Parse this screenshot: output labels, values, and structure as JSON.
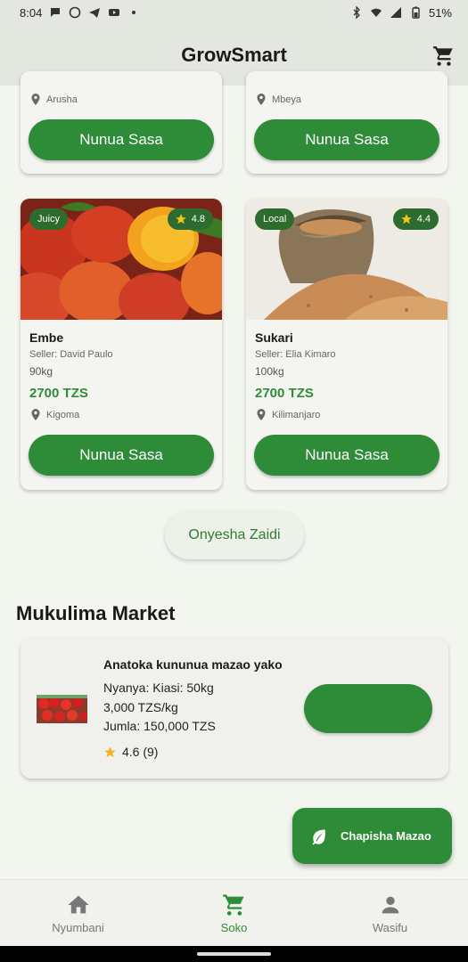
{
  "status_bar": {
    "time": "8:04",
    "battery": "51%"
  },
  "app_bar": {
    "title": "GrowSmart"
  },
  "top_products": [
    {
      "location": "Arusha",
      "buy_label": "Nunua Sasa"
    },
    {
      "location": "Mbeya",
      "buy_label": "Nunua Sasa"
    }
  ],
  "products": [
    {
      "tag": "Juicy",
      "rating": "4.8",
      "name": "Embe",
      "seller": "Seller: David Paulo",
      "quantity": "90kg",
      "price": "2700 TZS",
      "location": "Kigoma",
      "buy_label": "Nunua Sasa"
    },
    {
      "tag": "Local",
      "rating": "4.4",
      "name": "Sukari",
      "seller": "Seller: Elia Kimaro",
      "quantity": "100kg",
      "price": "2700 TZS",
      "location": "Kilimanjaro",
      "buy_label": "Nunua Sasa"
    }
  ],
  "show_more_label": "Onyesha Zaidi",
  "market": {
    "section_title": "Mukulima Market",
    "card": {
      "title": "Anatoka kununua mazao yako",
      "line1": "Nyanya: Kiasi: 50kg",
      "line2": "3,000 TZS/kg",
      "line3": "Jumla: 150,000 TZS",
      "rating": "4.6 (9)",
      "action_label": ""
    }
  },
  "fab_label": "Chapisha Mazao",
  "bottom_nav": [
    {
      "label": "Nyumbani",
      "icon": "home-icon",
      "active": false
    },
    {
      "label": "Soko",
      "icon": "cart-icon",
      "active": true
    },
    {
      "label": "Wasifu",
      "icon": "person-icon",
      "active": false
    }
  ],
  "colors": {
    "primary": "#2e8b37",
    "badge": "#2e6b2e",
    "background": "#f3f6ef",
    "appbar": "#e3e7df"
  }
}
